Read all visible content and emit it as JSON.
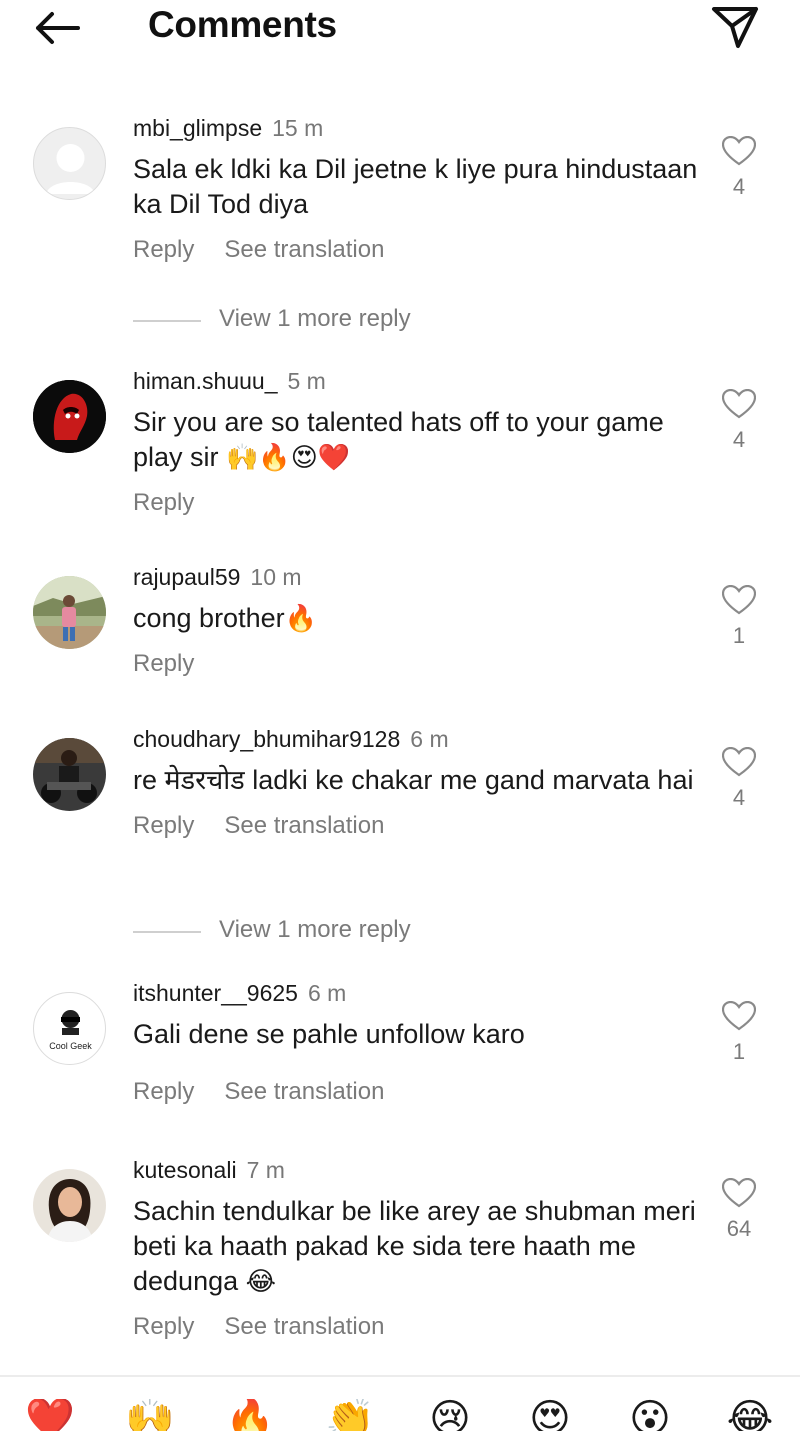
{
  "header": {
    "title": "Comments",
    "back_icon": "arrow-left-icon",
    "send_icon": "paper-plane-icon"
  },
  "comments": [
    {
      "username": "mbi_glimpse",
      "time": "15 m",
      "text": "Sala ek ldki ka Dil jeetne k liye pura hindustaan ka Dil Tod diya",
      "reply": "Reply",
      "see_translation": "See translation",
      "likes": "4",
      "view_more": "View 1 more reply"
    },
    {
      "username": "himan.shuuu_",
      "time": "5 m",
      "text": "Sir you are so talented hats off to your game play sir ",
      "emojis": "🙌🔥😍❤️",
      "reply": "Reply",
      "likes": "4"
    },
    {
      "username": "rajupaul59",
      "time": "10 m",
      "text": "cong brother",
      "emojis": "🔥",
      "reply": "Reply",
      "likes": "1"
    },
    {
      "username": "choudhary_bhumihar9128",
      "time": "6 m",
      "text": "re मेडरचोड ladki ke chakar me gand marvata hai",
      "reply": "Reply",
      "see_translation": "See translation",
      "likes": "4",
      "view_more": "View 1 more reply"
    },
    {
      "username": "itshunter__9625",
      "time": "6 m",
      "text": "Gali dene se pahle unfollow karo",
      "reply": "Reply",
      "see_translation": "See translation",
      "likes": "1",
      "avatar_text": "Cool Geek"
    },
    {
      "username": "kutesonali",
      "time": "7 m",
      "text": "Sachin tendulkar be like arey ae shubman meri beti ka haath pakad ke sida tere haath me dedunga ",
      "emojis": "😂",
      "reply": "Reply",
      "see_translation": "See translation",
      "likes": "64"
    }
  ],
  "emoji_bar": [
    "❤️",
    "🙌",
    "🔥",
    "👏",
    "😢",
    "😍",
    "😮",
    "😂"
  ],
  "colors": {
    "text": "#1a1a1a",
    "muted": "#7a7a7a",
    "divider": "#cfcfcf"
  }
}
